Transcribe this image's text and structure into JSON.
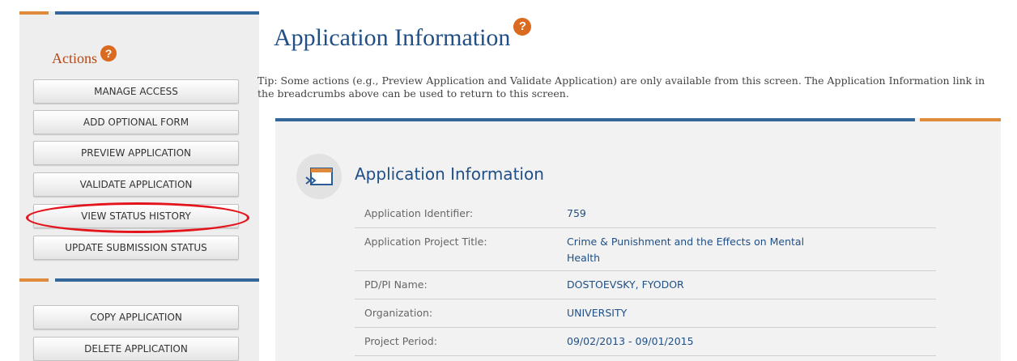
{
  "sidebar": {
    "title": "Actions",
    "help_glyph": "?",
    "buttons": [
      {
        "label": "MANAGE ACCESS"
      },
      {
        "label": "ADD OPTIONAL FORM"
      },
      {
        "label": "PREVIEW APPLICATION"
      },
      {
        "label": "VALIDATE APPLICATION"
      },
      {
        "label": "VIEW STATUS HISTORY"
      },
      {
        "label": "UPDATE SUBMISSION STATUS"
      }
    ],
    "secondary_buttons": [
      {
        "label": "COPY APPLICATION"
      },
      {
        "label": "DELETE APPLICATION"
      }
    ]
  },
  "main": {
    "title": "Application Information",
    "help_glyph": "?",
    "tip": "Tip: Some actions (e.g., Preview Application and Validate Application) are only available from this screen. The Application Information link in the breadcrumbs above can be used to return to this screen.",
    "section": {
      "title": "Application Information",
      "rows": [
        {
          "label": "Application Identifier:",
          "value": "759"
        },
        {
          "label": "Application Project Title:",
          "value": "Crime & Punishment and the Effects on Mental Health"
        },
        {
          "label": "PD/PI Name:",
          "value": "DOSTOEVSKY, FYODOR"
        },
        {
          "label": "Organization:",
          "value": "UNIVERSITY"
        },
        {
          "label": "Project Period:",
          "value": "09/02/2013 - 09/01/2015"
        }
      ]
    }
  },
  "colors": {
    "brand_blue": "#336699",
    "accent_orange": "#e08a3c",
    "highlight_red": "#e3141b"
  }
}
